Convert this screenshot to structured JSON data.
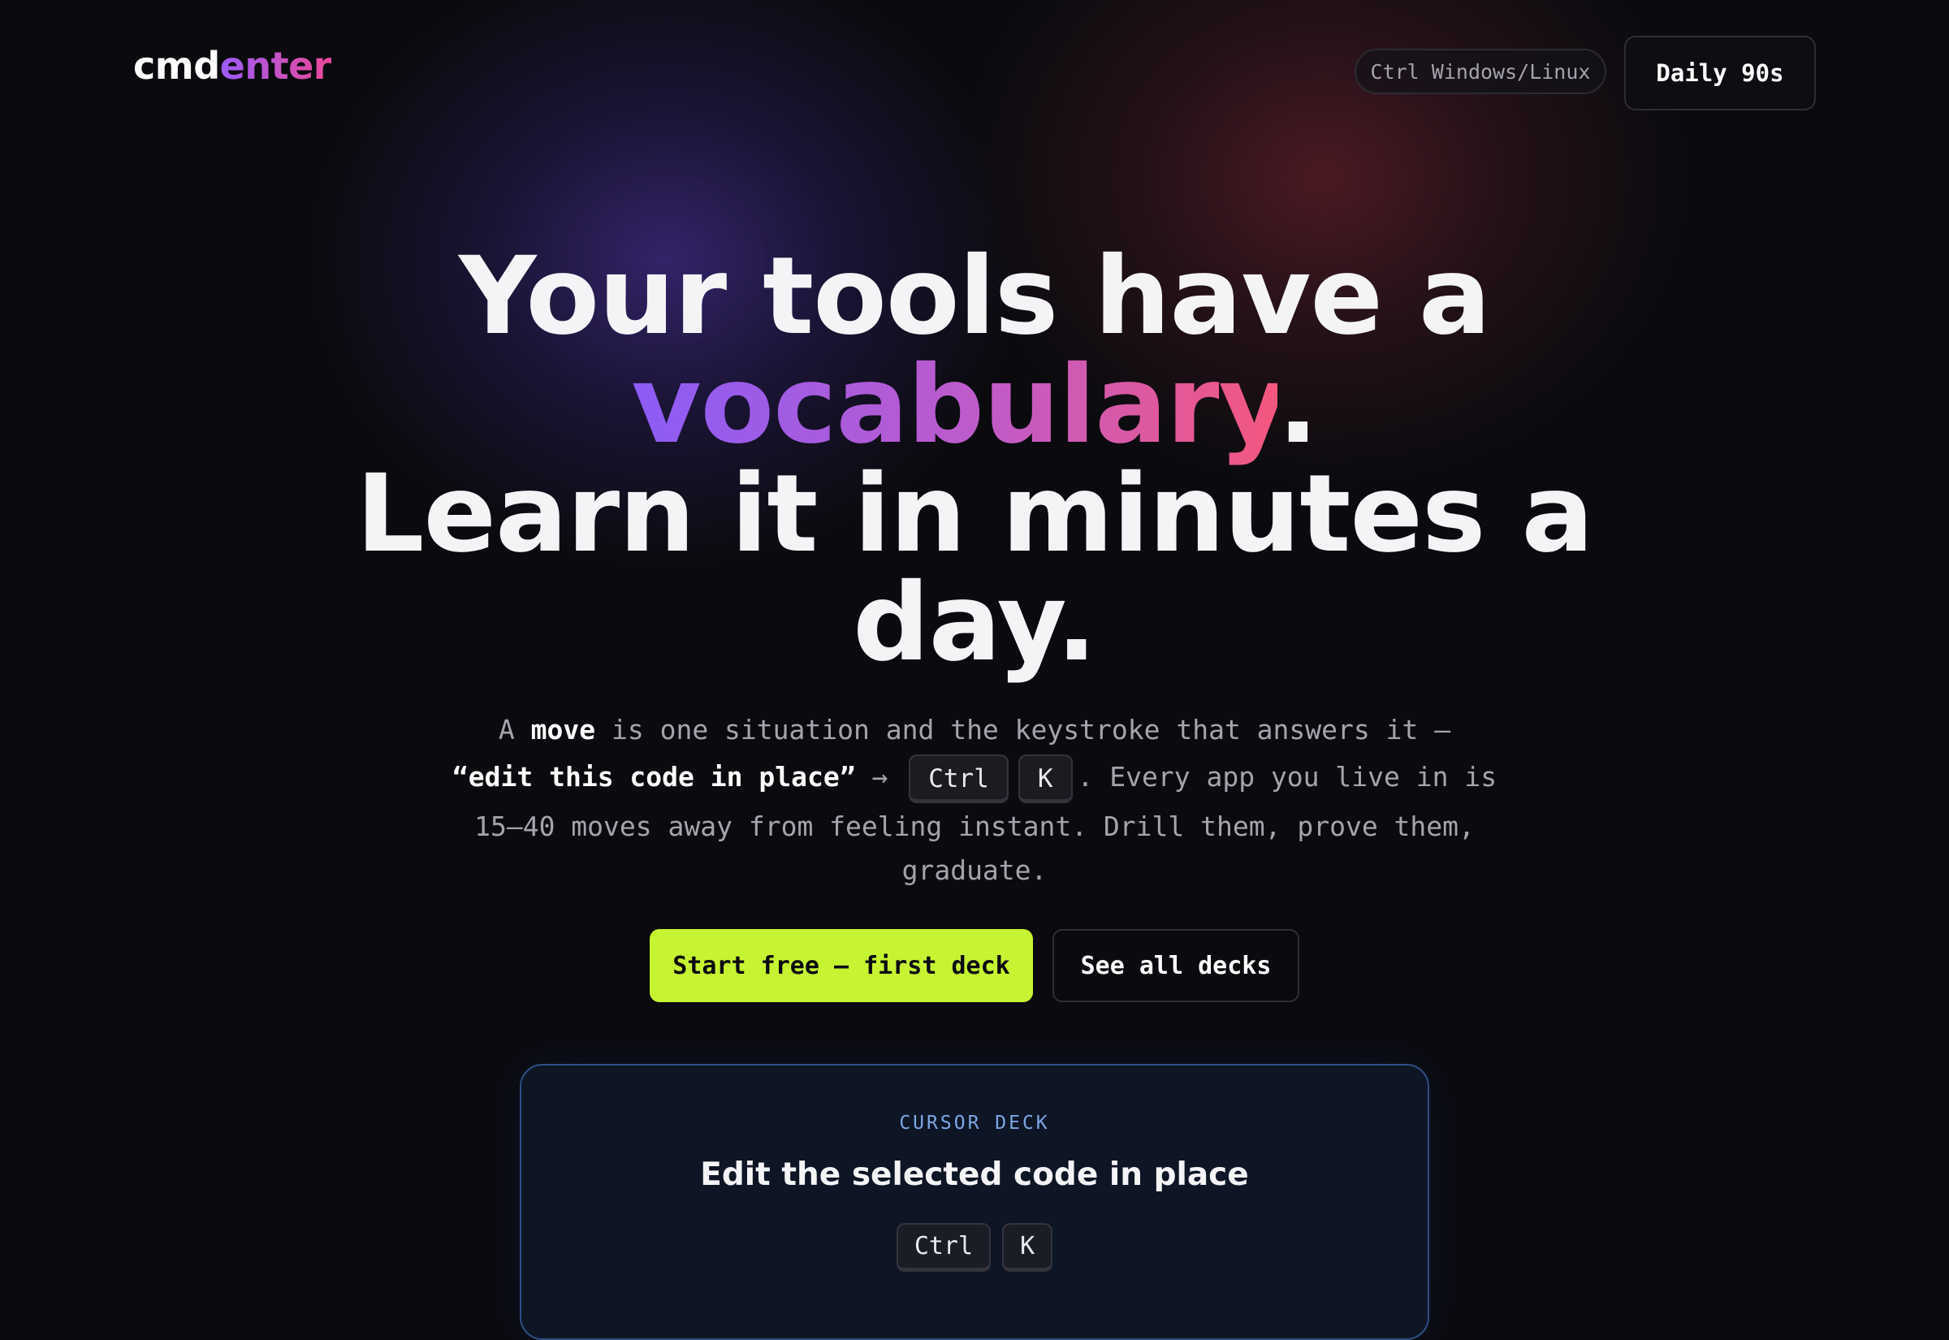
{
  "header": {
    "logo_part1": "cmd",
    "logo_part2": "enter",
    "os_toggle": "Ctrl Windows/Linux",
    "daily_button": "Daily 90s"
  },
  "hero": {
    "line1": "Your tools have a",
    "highlight": "vocabulary",
    "period1": ".",
    "line3": "Learn it in minutes a",
    "line4": "day.",
    "sub_a": "A ",
    "sub_move": "move",
    "sub_b": " is one situation and the keystroke that answers it —",
    "sub_quote": "“edit this code in place”",
    "sub_arrow": " → ",
    "key1": "Ctrl",
    "key2": "K",
    "sub_c": ". Every app you live in is",
    "sub_d": "15–40 moves away from feeling instant. Drill them, prove them,",
    "sub_e": "graduate."
  },
  "actions": {
    "primary": "Start free — first deck",
    "secondary": "See all decks"
  },
  "deck_card": {
    "eyebrow": "CURSOR DECK",
    "title": "Edit the selected code in place",
    "key1": "Ctrl",
    "key2": "K"
  },
  "colors": {
    "background": "#0b0b0f",
    "accent_lime": "#c6f432",
    "gradient_start": "#8b5cf6",
    "gradient_end": "#f4577e",
    "card_border": "#2f4f86"
  }
}
